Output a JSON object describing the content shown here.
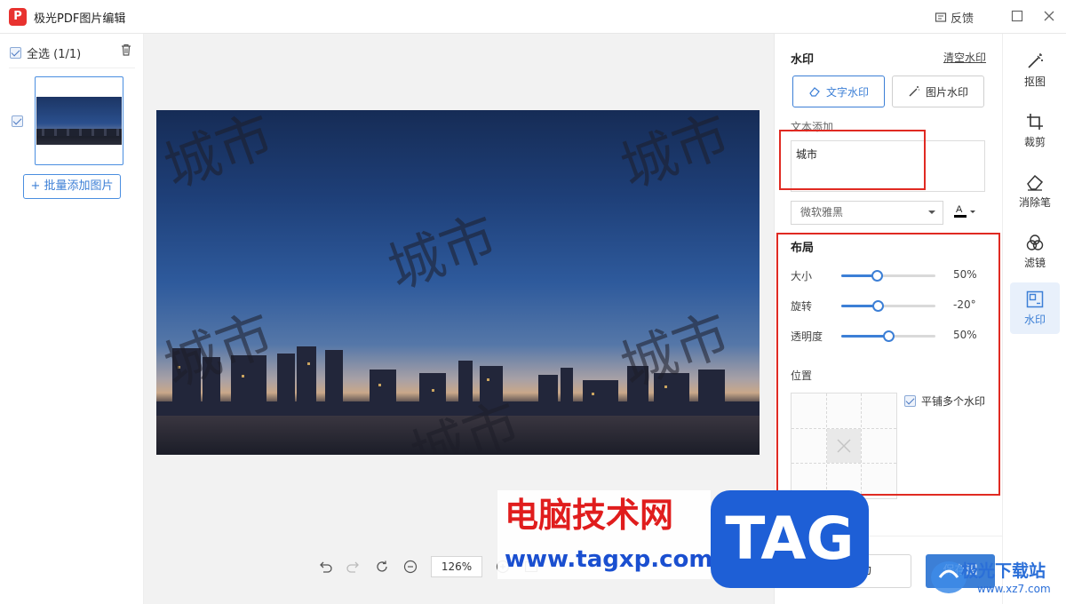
{
  "app": {
    "logo_letter": "P",
    "title": "极光PDF图片编辑",
    "feedback_label": "反馈"
  },
  "left": {
    "select_all_label": "全选 (1/1)",
    "add_button_label": "+ 批量添加图片"
  },
  "canvas": {
    "watermark_text": "城市",
    "zoom_value": "126%"
  },
  "options": {
    "title": "水印",
    "clear_label": "清空水印",
    "text_wm_label": "文字水印",
    "image_wm_label": "图片水印",
    "text_add_label": "文本添加",
    "text_value": "城市",
    "font_value": "微软雅黑",
    "font_color": "#000000",
    "layout_title": "布局",
    "sliders": [
      {
        "label": "大小",
        "value": "50%",
        "fraction": 0.38
      },
      {
        "label": "旋转",
        "value": "-20°",
        "fraction": 0.39
      },
      {
        "label": "透明度",
        "value": "50%",
        "fraction": 0.5
      }
    ],
    "position_label": "位置",
    "tile_label": "平铺多个水印",
    "save_as_label": "另存为",
    "save_image_label": "保存图"
  },
  "rail": {
    "items": [
      "抠图",
      "裁剪",
      "消除笔",
      "滤镜",
      "水印"
    ],
    "active": "水印"
  },
  "branding": {
    "cn": "电脑技术网",
    "url": "www.tagxp.com",
    "tag": "TAG",
    "xz": "极光下载站",
    "xz_url": "www.xz7.com"
  },
  "colors": {
    "accent": "#3c7fd6",
    "highlight": "#e02a22"
  }
}
